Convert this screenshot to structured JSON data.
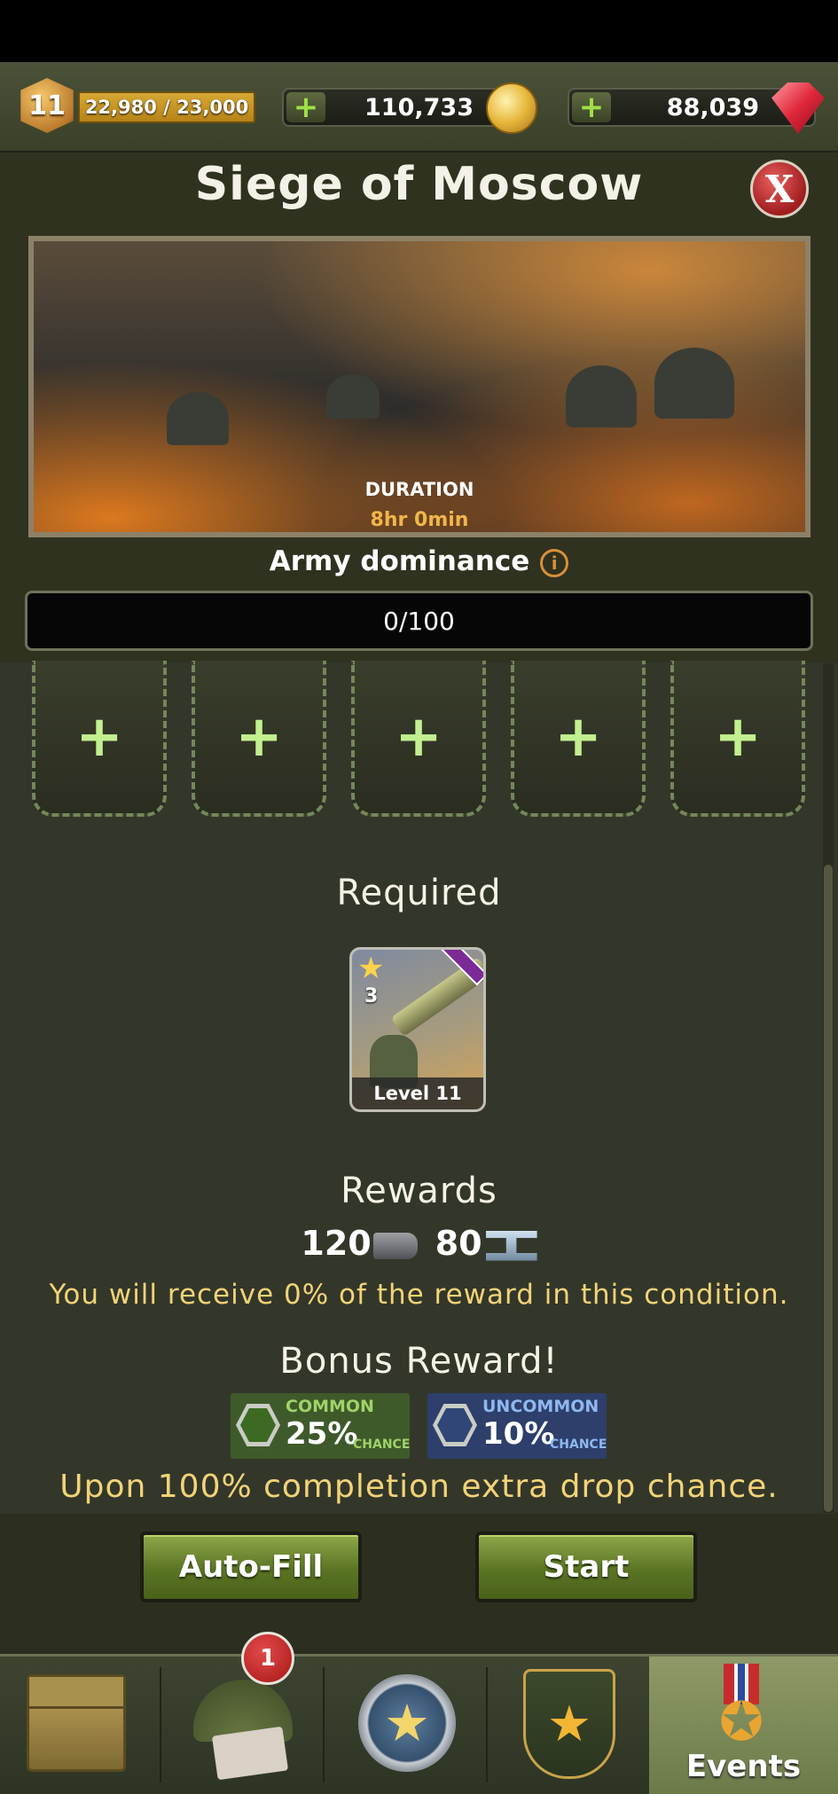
{
  "status": {
    "rank": "11",
    "xp": "22,980 / 23,000",
    "coins": "110,733",
    "gems": "88,039"
  },
  "dialog": {
    "title": "Siege of Moscow",
    "close_label": "X",
    "duration_label": "DURATION",
    "duration_value": "8hr 0min",
    "army_dominance_label": "Army dominance",
    "info_glyph": "i",
    "dominance_value": "0/100"
  },
  "slots": [
    "+",
    "+",
    "+",
    "+",
    "+"
  ],
  "required": {
    "heading": "Required",
    "card": {
      "stars": "3",
      "level": "Level 11",
      "icon": "machine-gun-unit"
    }
  },
  "rewards": {
    "heading": "Rewards",
    "items": [
      {
        "amount": "120",
        "icon": "bullet-icon"
      },
      {
        "amount": "80",
        "icon": "steel-beam-icon"
      }
    ],
    "condition_note": "You will receive 0% of the reward in this condition."
  },
  "bonus": {
    "heading": "Bonus Reward!",
    "chances": [
      {
        "tier": "COMMON",
        "percent": "25%",
        "word": "CHANCE",
        "color": "#3f5a2a",
        "text_color": "#9fd36a",
        "hex_color": "#3c6a22"
      },
      {
        "tier": "UNCOMMON",
        "percent": "10%",
        "word": "CHANCE",
        "color": "#2d3f6a",
        "text_color": "#8fb8f0",
        "hex_color": "#2f4676"
      }
    ],
    "note": "Upon 100% completion extra drop chance."
  },
  "actions": {
    "autofill_label": "Auto-Fill",
    "start_label": "Start"
  },
  "nav": {
    "items": [
      {
        "icon": "supply-crate-icon"
      },
      {
        "icon": "helmet-cards-icon",
        "badge": "1"
      },
      {
        "icon": "star-medal-icon"
      },
      {
        "icon": "wreath-emblem-icon"
      },
      {
        "icon": "events-medal-icon",
        "label": "Events"
      }
    ]
  },
  "colors": {
    "accent_green": "#9fe046",
    "note_yellow": "#f2d377",
    "duration_orange": "#f1b64a"
  }
}
